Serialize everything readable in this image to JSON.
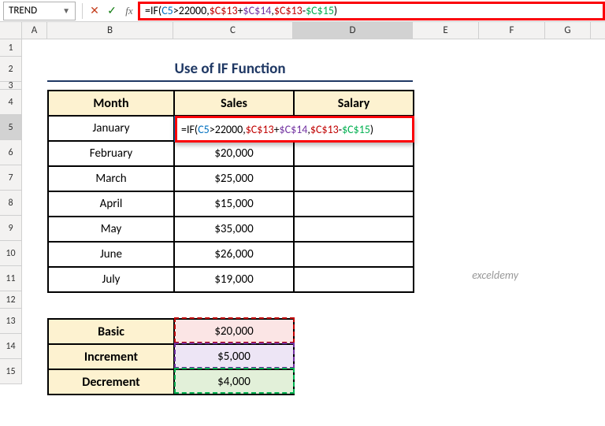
{
  "nameBox": "TREND",
  "formulaBarIcons": {
    "cancel": "✕",
    "confirm": "✓",
    "fx": "fx"
  },
  "formula": {
    "p1": "=IF(",
    "c5": "C5",
    "p2": ">22000,",
    "c13a": "$C$13",
    "plus": "+",
    "c14": "$C$14",
    "comma": ",",
    "c13b": "$C$13",
    "minus": "-",
    "c15": "$C$15",
    "p3": ")"
  },
  "colHeaders": [
    "A",
    "B",
    "C",
    "D",
    "E",
    "F",
    "G"
  ],
  "rowHeaders": [
    "1",
    "2",
    "3",
    "4",
    "5",
    "6",
    "7",
    "8",
    "9",
    "10",
    "11",
    "12",
    "13",
    "14",
    "15"
  ],
  "title": "Use of IF Function",
  "table": {
    "headers": {
      "month": "Month",
      "sales": "Sales",
      "salary": "Salary"
    },
    "rows": [
      {
        "month": "January",
        "sales": ""
      },
      {
        "month": "February",
        "sales": "$20,000"
      },
      {
        "month": "March",
        "sales": "$25,000"
      },
      {
        "month": "April",
        "sales": "$15,000"
      },
      {
        "month": "May",
        "sales": "$35,000"
      },
      {
        "month": "June",
        "sales": "$26,000"
      },
      {
        "month": "July",
        "sales": "$19,000"
      }
    ]
  },
  "params": {
    "basic": {
      "label": "Basic",
      "value": "$20,000"
    },
    "increment": {
      "label": "Increment",
      "value": "$5,000"
    },
    "decrement": {
      "label": "Decrement",
      "value": "$4,000"
    }
  },
  "watermark": "exceldemy"
}
